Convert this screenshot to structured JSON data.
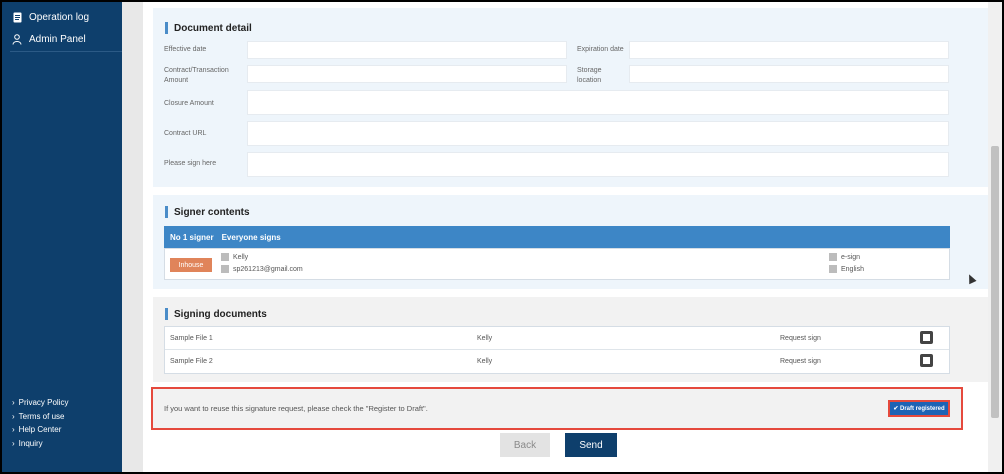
{
  "sidebar": {
    "items": [
      {
        "label": "Operation log",
        "icon": "document-icon"
      },
      {
        "label": "Admin Panel",
        "icon": "user-icon"
      }
    ],
    "footer_links": [
      {
        "label": "Privacy Policy"
      },
      {
        "label": "Terms of use"
      },
      {
        "label": "Help Center"
      },
      {
        "label": "Inquiry"
      }
    ]
  },
  "document_detail": {
    "title": "Document detail",
    "fields": {
      "effective_date": {
        "label": "Effective date",
        "value": ""
      },
      "expiration_date": {
        "label": "Expiration date",
        "value": ""
      },
      "contract_amount": {
        "label": "Contract/Transaction Amount",
        "value": ""
      },
      "storage_location": {
        "label": "Storage location",
        "value": ""
      },
      "closure_amount": {
        "label": "Closure Amount",
        "value": ""
      },
      "contract_url": {
        "label": "Contract URL",
        "value": ""
      },
      "please_sign_here": {
        "label": "Please sign here",
        "value": ""
      }
    }
  },
  "signer_contents": {
    "title": "Signer contents",
    "header_number": "No 1 signer",
    "header_mode": "Everyone signs",
    "signer": {
      "type_button": "Inhouse",
      "name": "Kelly",
      "email": "sp261213@gmail.com",
      "method": "e-sign",
      "language": "English"
    }
  },
  "signing_documents": {
    "title": "Signing documents",
    "rows": [
      {
        "file": "Sample File 1",
        "signer": "Kelly",
        "action": "Request sign"
      },
      {
        "file": "Sample File 2",
        "signer": "Kelly",
        "action": "Request sign"
      }
    ]
  },
  "draft": {
    "message": "If you want to reuse this signature request, please check the \"Register to Draft\".",
    "button_label": "✔ Draft registered"
  },
  "actions": {
    "back_label": "Back",
    "send_label": "Send"
  },
  "colors": {
    "sidebar": "#0e3f6c",
    "accent": "#3d86c6",
    "inhouse": "#e0845a",
    "highlight": "#e5493d"
  }
}
